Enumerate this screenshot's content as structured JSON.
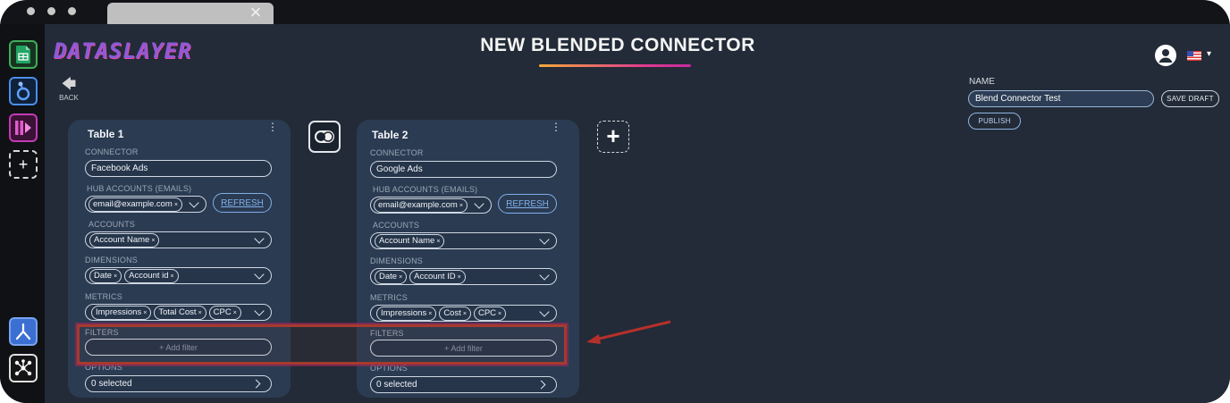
{
  "window": {
    "tab_close": "×"
  },
  "sidebar": {
    "add_label": "+"
  },
  "app": {
    "logo": "DATASLAYER",
    "back_label": "BACK",
    "back_arrow": "🡄"
  },
  "header": {
    "title": "NEW BLENDED CONNECTOR"
  },
  "right_panel": {
    "name_label": "NAME",
    "name_value": "Blend Connector Test",
    "save_draft": "SAVE DRAFT",
    "publish": "PUBLISH"
  },
  "labels": {
    "connector": "CONNECTOR",
    "hub_accounts": "HUB ACCOUNTS (EMAILS)",
    "accounts": "ACCOUNTS",
    "dimensions": "DIMENSIONS",
    "metrics": "METRICS",
    "filters": "FILTERS",
    "options": "OPTIONS",
    "refresh": "REFRESH",
    "add_filter": "+ Add filter",
    "chip_remove": "×",
    "add_table": "+"
  },
  "tables": [
    {
      "title": "Table 1",
      "connector": "Facebook Ads",
      "hub_account": "email@example.com",
      "account": "Account Name",
      "dimensions": [
        "Date",
        "Account id"
      ],
      "metrics": [
        "Impressions",
        "Total Cost",
        "CPC"
      ],
      "options": "0 selected"
    },
    {
      "title": "Table 2",
      "connector": "Google Ads",
      "hub_account": "email@example.com",
      "account": "Account Name",
      "dimensions": [
        "Date",
        "Account ID"
      ],
      "metrics": [
        "Impressions",
        "Cost",
        "CPC"
      ],
      "options": "0 selected"
    }
  ],
  "colors": {
    "background": "#222b37",
    "card": "#2b3b52",
    "accent_link": "#7fb0ea",
    "highlight": "#a63a2e",
    "title_underline": [
      "#f2a93b",
      "#e2398f"
    ]
  },
  "icons": {
    "sidebar": [
      "google-sheets-icon",
      "looker-studio-icon",
      "power-bi-icon",
      "add-icon",
      "blend-icon",
      "hub-icon"
    ],
    "header": [
      "user-avatar-icon",
      "us-flag-icon",
      "caret-down-icon"
    ]
  }
}
